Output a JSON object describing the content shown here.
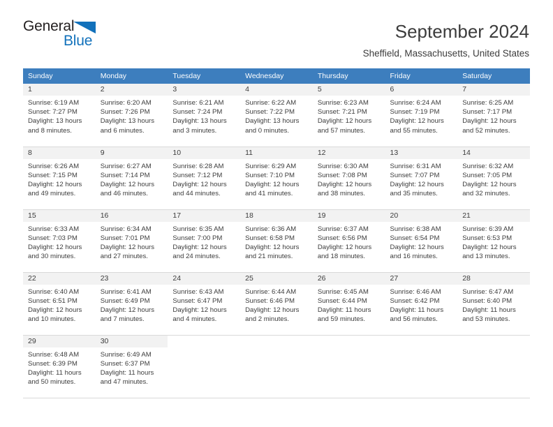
{
  "brand": {
    "name_part1": "General",
    "name_part2": "Blue",
    "triangle_icon": "triangle-icon",
    "accent_color": "#1271bb"
  },
  "header": {
    "title": "September 2024",
    "subtitle": "Sheffield, Massachusetts, United States"
  },
  "calendar": {
    "header_bg": "#3d7ebe",
    "daynum_bg": "#f2f2f2",
    "weekdays": [
      "Sunday",
      "Monday",
      "Tuesday",
      "Wednesday",
      "Thursday",
      "Friday",
      "Saturday"
    ],
    "weeks": [
      [
        {
          "day": "1",
          "sunrise": "Sunrise: 6:19 AM",
          "sunset": "Sunset: 7:27 PM",
          "daylight1": "Daylight: 13 hours",
          "daylight2": "and 8 minutes."
        },
        {
          "day": "2",
          "sunrise": "Sunrise: 6:20 AM",
          "sunset": "Sunset: 7:26 PM",
          "daylight1": "Daylight: 13 hours",
          "daylight2": "and 6 minutes."
        },
        {
          "day": "3",
          "sunrise": "Sunrise: 6:21 AM",
          "sunset": "Sunset: 7:24 PM",
          "daylight1": "Daylight: 13 hours",
          "daylight2": "and 3 minutes."
        },
        {
          "day": "4",
          "sunrise": "Sunrise: 6:22 AM",
          "sunset": "Sunset: 7:22 PM",
          "daylight1": "Daylight: 13 hours",
          "daylight2": "and 0 minutes."
        },
        {
          "day": "5",
          "sunrise": "Sunrise: 6:23 AM",
          "sunset": "Sunset: 7:21 PM",
          "daylight1": "Daylight: 12 hours",
          "daylight2": "and 57 minutes."
        },
        {
          "day": "6",
          "sunrise": "Sunrise: 6:24 AM",
          "sunset": "Sunset: 7:19 PM",
          "daylight1": "Daylight: 12 hours",
          "daylight2": "and 55 minutes."
        },
        {
          "day": "7",
          "sunrise": "Sunrise: 6:25 AM",
          "sunset": "Sunset: 7:17 PM",
          "daylight1": "Daylight: 12 hours",
          "daylight2": "and 52 minutes."
        }
      ],
      [
        {
          "day": "8",
          "sunrise": "Sunrise: 6:26 AM",
          "sunset": "Sunset: 7:15 PM",
          "daylight1": "Daylight: 12 hours",
          "daylight2": "and 49 minutes."
        },
        {
          "day": "9",
          "sunrise": "Sunrise: 6:27 AM",
          "sunset": "Sunset: 7:14 PM",
          "daylight1": "Daylight: 12 hours",
          "daylight2": "and 46 minutes."
        },
        {
          "day": "10",
          "sunrise": "Sunrise: 6:28 AM",
          "sunset": "Sunset: 7:12 PM",
          "daylight1": "Daylight: 12 hours",
          "daylight2": "and 44 minutes."
        },
        {
          "day": "11",
          "sunrise": "Sunrise: 6:29 AM",
          "sunset": "Sunset: 7:10 PM",
          "daylight1": "Daylight: 12 hours",
          "daylight2": "and 41 minutes."
        },
        {
          "day": "12",
          "sunrise": "Sunrise: 6:30 AM",
          "sunset": "Sunset: 7:08 PM",
          "daylight1": "Daylight: 12 hours",
          "daylight2": "and 38 minutes."
        },
        {
          "day": "13",
          "sunrise": "Sunrise: 6:31 AM",
          "sunset": "Sunset: 7:07 PM",
          "daylight1": "Daylight: 12 hours",
          "daylight2": "and 35 minutes."
        },
        {
          "day": "14",
          "sunrise": "Sunrise: 6:32 AM",
          "sunset": "Sunset: 7:05 PM",
          "daylight1": "Daylight: 12 hours",
          "daylight2": "and 32 minutes."
        }
      ],
      [
        {
          "day": "15",
          "sunrise": "Sunrise: 6:33 AM",
          "sunset": "Sunset: 7:03 PM",
          "daylight1": "Daylight: 12 hours",
          "daylight2": "and 30 minutes."
        },
        {
          "day": "16",
          "sunrise": "Sunrise: 6:34 AM",
          "sunset": "Sunset: 7:01 PM",
          "daylight1": "Daylight: 12 hours",
          "daylight2": "and 27 minutes."
        },
        {
          "day": "17",
          "sunrise": "Sunrise: 6:35 AM",
          "sunset": "Sunset: 7:00 PM",
          "daylight1": "Daylight: 12 hours",
          "daylight2": "and 24 minutes."
        },
        {
          "day": "18",
          "sunrise": "Sunrise: 6:36 AM",
          "sunset": "Sunset: 6:58 PM",
          "daylight1": "Daylight: 12 hours",
          "daylight2": "and 21 minutes."
        },
        {
          "day": "19",
          "sunrise": "Sunrise: 6:37 AM",
          "sunset": "Sunset: 6:56 PM",
          "daylight1": "Daylight: 12 hours",
          "daylight2": "and 18 minutes."
        },
        {
          "day": "20",
          "sunrise": "Sunrise: 6:38 AM",
          "sunset": "Sunset: 6:54 PM",
          "daylight1": "Daylight: 12 hours",
          "daylight2": "and 16 minutes."
        },
        {
          "day": "21",
          "sunrise": "Sunrise: 6:39 AM",
          "sunset": "Sunset: 6:53 PM",
          "daylight1": "Daylight: 12 hours",
          "daylight2": "and 13 minutes."
        }
      ],
      [
        {
          "day": "22",
          "sunrise": "Sunrise: 6:40 AM",
          "sunset": "Sunset: 6:51 PM",
          "daylight1": "Daylight: 12 hours",
          "daylight2": "and 10 minutes."
        },
        {
          "day": "23",
          "sunrise": "Sunrise: 6:41 AM",
          "sunset": "Sunset: 6:49 PM",
          "daylight1": "Daylight: 12 hours",
          "daylight2": "and 7 minutes."
        },
        {
          "day": "24",
          "sunrise": "Sunrise: 6:43 AM",
          "sunset": "Sunset: 6:47 PM",
          "daylight1": "Daylight: 12 hours",
          "daylight2": "and 4 minutes."
        },
        {
          "day": "25",
          "sunrise": "Sunrise: 6:44 AM",
          "sunset": "Sunset: 6:46 PM",
          "daylight1": "Daylight: 12 hours",
          "daylight2": "and 2 minutes."
        },
        {
          "day": "26",
          "sunrise": "Sunrise: 6:45 AM",
          "sunset": "Sunset: 6:44 PM",
          "daylight1": "Daylight: 11 hours",
          "daylight2": "and 59 minutes."
        },
        {
          "day": "27",
          "sunrise": "Sunrise: 6:46 AM",
          "sunset": "Sunset: 6:42 PM",
          "daylight1": "Daylight: 11 hours",
          "daylight2": "and 56 minutes."
        },
        {
          "day": "28",
          "sunrise": "Sunrise: 6:47 AM",
          "sunset": "Sunset: 6:40 PM",
          "daylight1": "Daylight: 11 hours",
          "daylight2": "and 53 minutes."
        }
      ],
      [
        {
          "day": "29",
          "sunrise": "Sunrise: 6:48 AM",
          "sunset": "Sunset: 6:39 PM",
          "daylight1": "Daylight: 11 hours",
          "daylight2": "and 50 minutes."
        },
        {
          "day": "30",
          "sunrise": "Sunrise: 6:49 AM",
          "sunset": "Sunset: 6:37 PM",
          "daylight1": "Daylight: 11 hours",
          "daylight2": "and 47 minutes."
        },
        {
          "day": "",
          "sunrise": "",
          "sunset": "",
          "daylight1": "",
          "daylight2": ""
        },
        {
          "day": "",
          "sunrise": "",
          "sunset": "",
          "daylight1": "",
          "daylight2": ""
        },
        {
          "day": "",
          "sunrise": "",
          "sunset": "",
          "daylight1": "",
          "daylight2": ""
        },
        {
          "day": "",
          "sunrise": "",
          "sunset": "",
          "daylight1": "",
          "daylight2": ""
        },
        {
          "day": "",
          "sunrise": "",
          "sunset": "",
          "daylight1": "",
          "daylight2": ""
        }
      ]
    ]
  }
}
